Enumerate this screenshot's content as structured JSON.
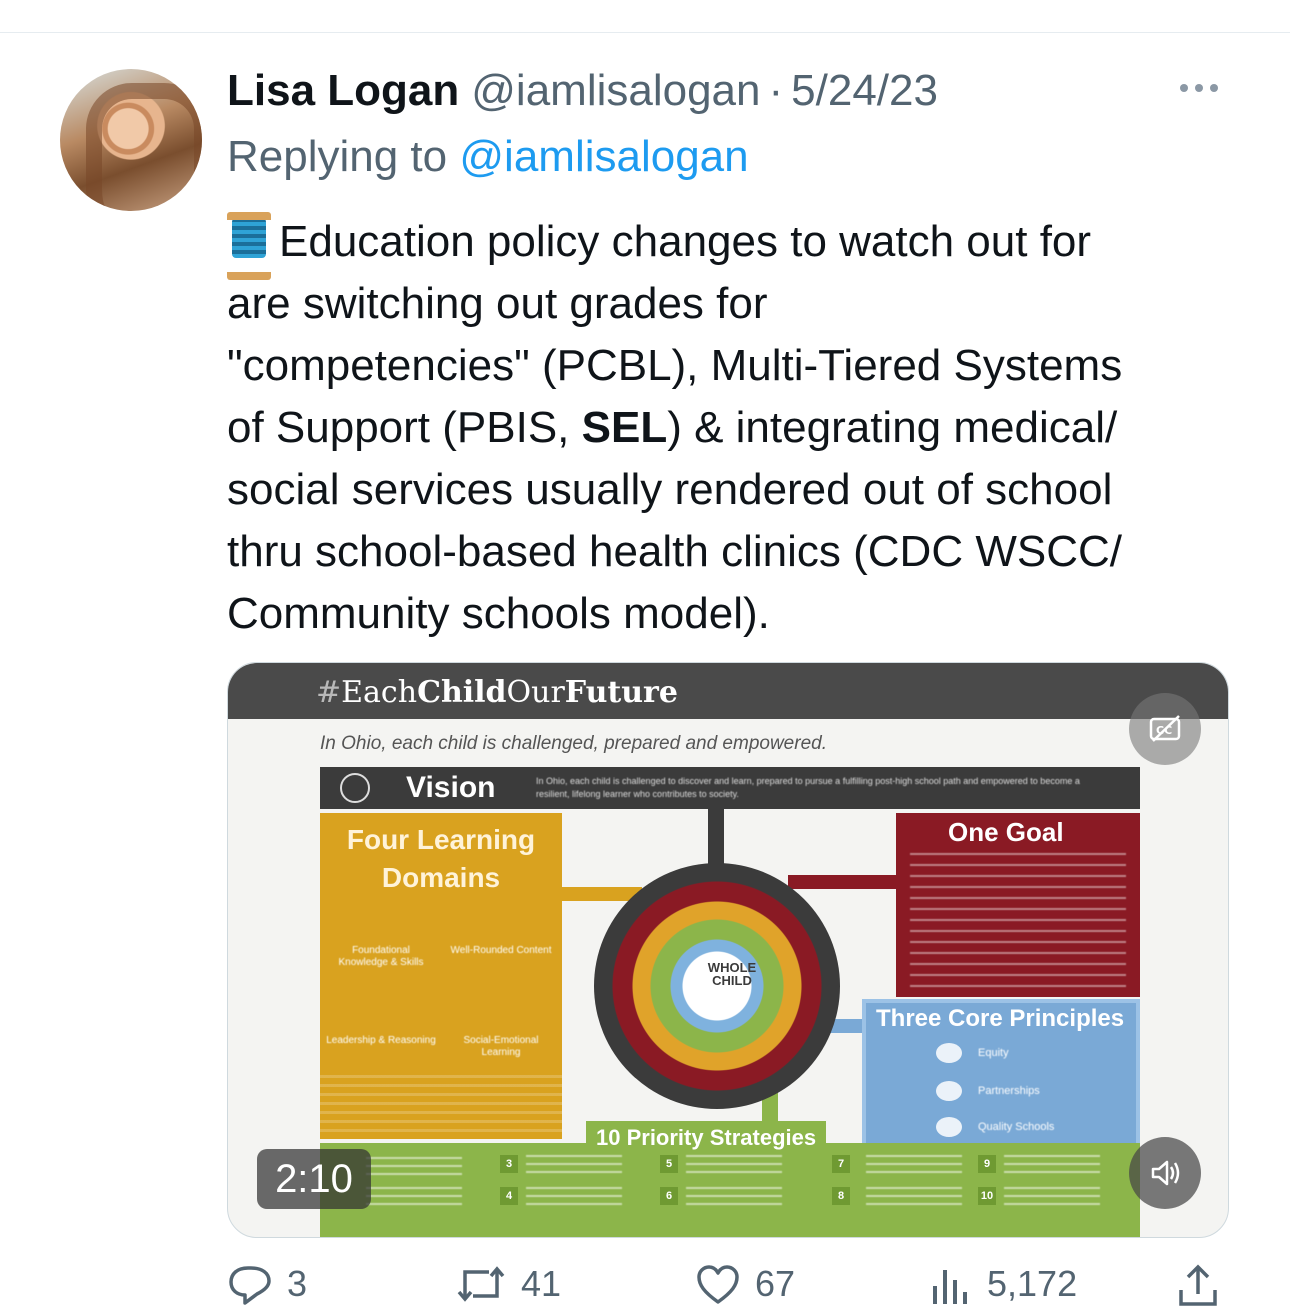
{
  "tweet": {
    "author_name": "Lisa Logan",
    "author_handle": "@iamlisalogan",
    "separator": "·",
    "date": "5/24/23",
    "replying_prefix": "Replying to",
    "replying_handle": "@iamlisalogan",
    "text_lines": [
      "Education policy changes to watch out for",
      "are switching out grades for",
      "\"competencies\" (PCBL), Multi-Tiered Systems",
      "of Support (PBIS, ",
      "SEL",
      ") & integrating medical/",
      "social services usually rendered out of school",
      "thru school-based health clinics (CDC WSCC/",
      "Community schools model)."
    ],
    "thread_emoji": "spool-of-thread-icon"
  },
  "media": {
    "video_duration": "2:10",
    "banner": {
      "hash": "#",
      "each": "Each",
      "child": "Child",
      "our": "Our",
      "future": "Future"
    },
    "tagline": "In Ohio, each child is challenged, prepared and empowered.",
    "vision_label": "Vision",
    "vision_text": "In Ohio, each child is challenged to discover and learn, prepared to pursue a fulfilling post-high school path and empowered to become a resilient, lifelong learner who contributes to society.",
    "four_title_1": "Four Learning",
    "four_title_2": "Domains",
    "domains": [
      "Foundational Knowledge & Skills",
      "Well-Rounded Content",
      "Leadership & Reasoning",
      "Social-Emotional Learning"
    ],
    "goal_title": "One Goal",
    "core_title": "Three Core Principles",
    "core_items": [
      "Equity",
      "Partnerships",
      "Quality Schools"
    ],
    "center_label_1": "WHOLE",
    "center_label_2": "CHILD",
    "strategies_title": "10 Priority Strategies",
    "strategy_numbers": [
      "3",
      "4",
      "5",
      "6",
      "7",
      "8",
      "9",
      "10"
    ]
  },
  "actions": {
    "replies": "3",
    "reposts": "41",
    "likes": "67",
    "views": "5,172"
  },
  "colors": {
    "link": "#1d9bf0",
    "secondary_text": "#536471",
    "primary_text": "#0f1419"
  }
}
